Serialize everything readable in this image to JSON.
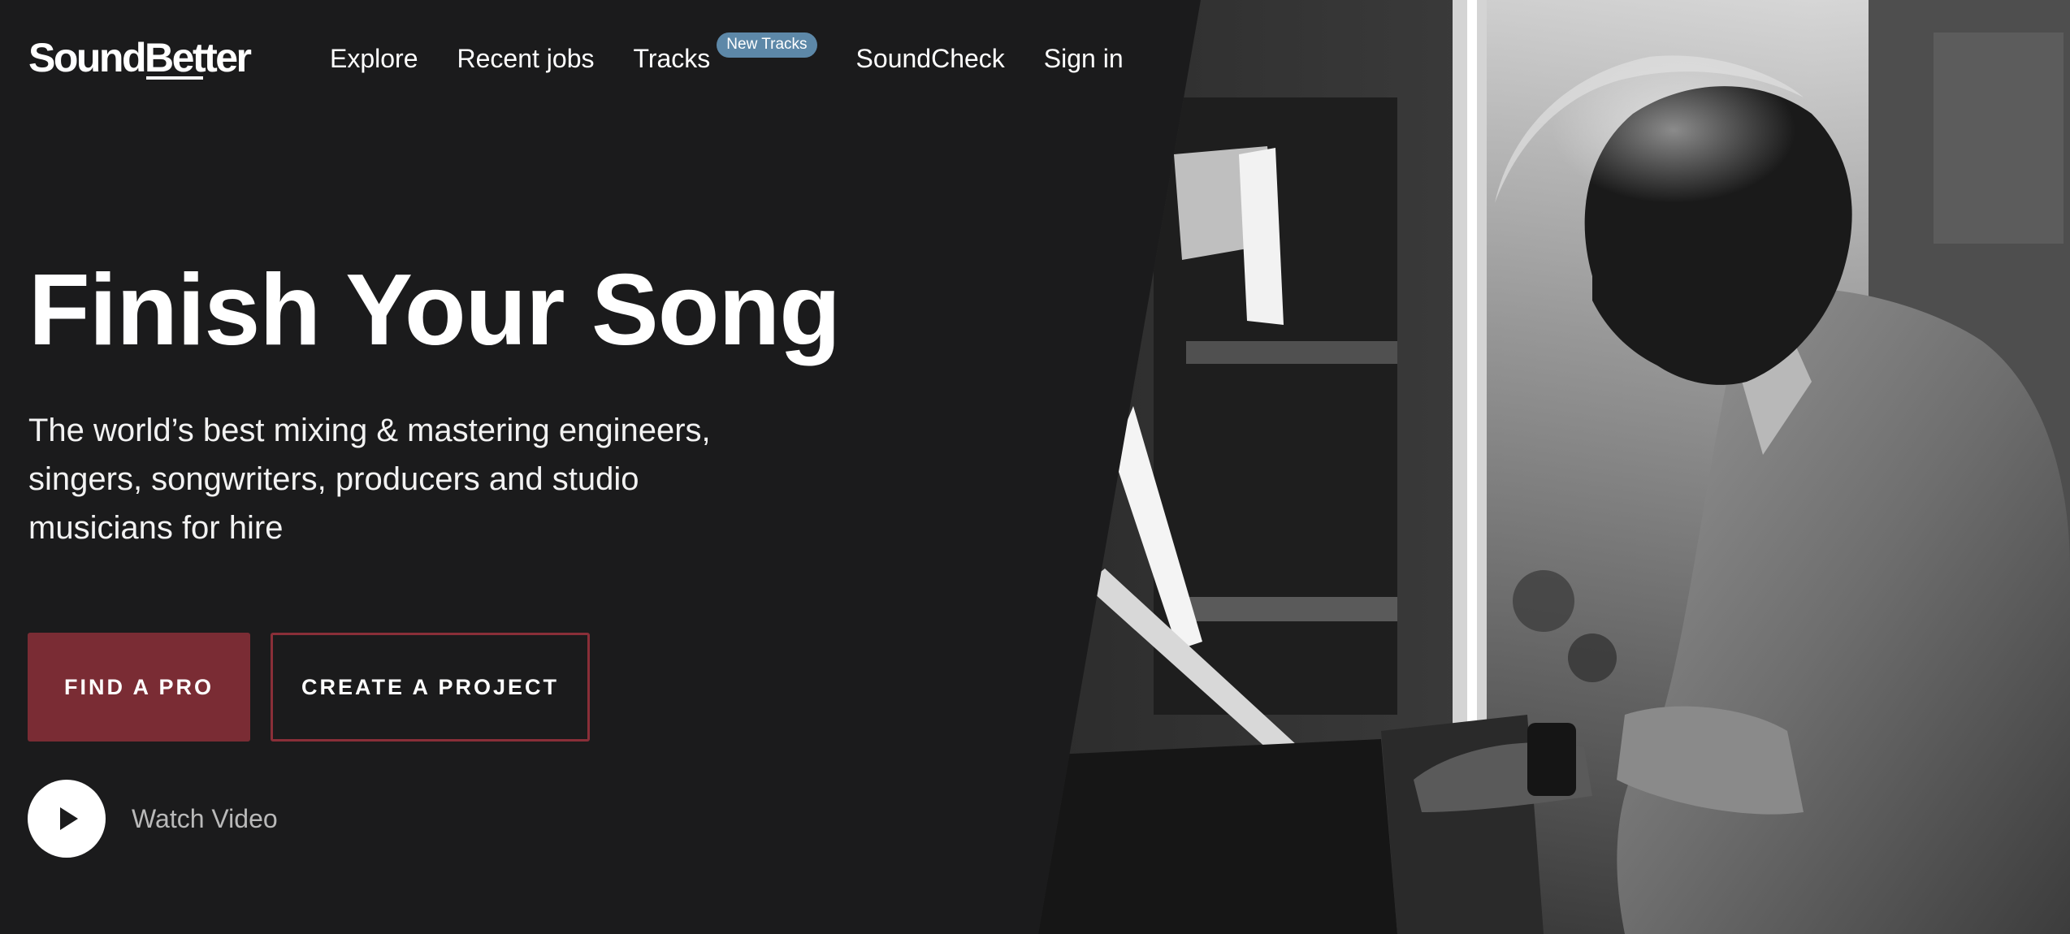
{
  "brand": {
    "logo_prefix": "Sound",
    "logo_suffix": "Better"
  },
  "nav": {
    "items": [
      {
        "label": "Explore"
      },
      {
        "label": "Recent jobs"
      },
      {
        "label": "Tracks",
        "badge": "New Tracks"
      },
      {
        "label": "SoundCheck"
      },
      {
        "label": "Sign in"
      }
    ]
  },
  "hero": {
    "title": "Finish Your Song",
    "subtitle": "The world’s best mixing & mastering engineers, singers, songwriters, producers and studio musicians for hire",
    "primary_cta": "FIND A PRO",
    "secondary_cta": "CREATE A PROJECT",
    "video_label": "Watch Video"
  },
  "colors": {
    "background": "#1b1b1c",
    "primary_button": "#7a2c34",
    "secondary_button_border": "#8a2f38",
    "badge": "#5d88a8"
  },
  "icons": {
    "play": "play-icon"
  }
}
